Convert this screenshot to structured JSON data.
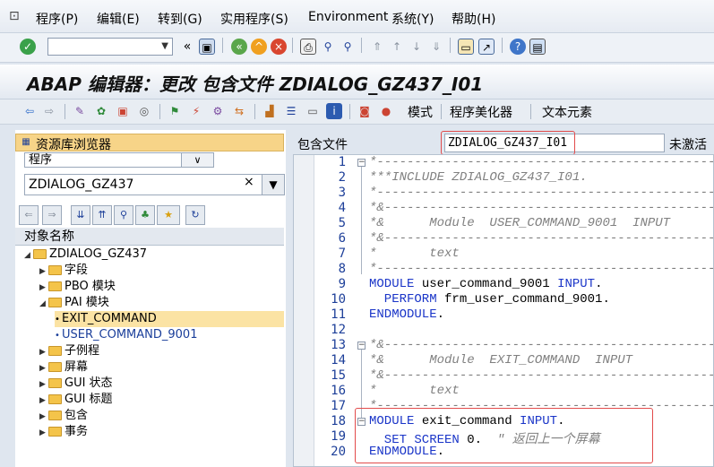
{
  "menu": {
    "items": [
      "程序(P)",
      "编辑(E)",
      "转到(G)",
      "实用程序(S)",
      "Environment",
      "系统(Y)",
      "帮助(H)"
    ]
  },
  "title": "ABAP 编辑器：更改 包含文件 ZDIALOG_GZ437_I01",
  "app_toolbar": {
    "mode_label": "模式",
    "pretty_printer_label": "程序美化器",
    "text_elements_label": "文本元素"
  },
  "repository_browser": {
    "header": "资源库浏览器",
    "object_type": "程序",
    "object_name": "ZDIALOG_GZ437",
    "clear_symbol": "×",
    "column_header": "对象名称",
    "tree": [
      {
        "label": "ZDIALOG_GZ437",
        "level": 0,
        "expanded": true,
        "folder": true
      },
      {
        "label": "字段",
        "level": 1,
        "expanded": false,
        "folder": true
      },
      {
        "label": "PBO 模块",
        "level": 1,
        "expanded": false,
        "folder": true
      },
      {
        "label": "PAI 模块",
        "level": 1,
        "expanded": true,
        "folder": true
      },
      {
        "label": "EXIT_COMMAND",
        "level": 2,
        "selected": true
      },
      {
        "label": "USER_COMMAND_9001",
        "level": 2,
        "selected": false
      },
      {
        "label": "子例程",
        "level": 1,
        "expanded": false,
        "folder": true
      },
      {
        "label": "屏幕",
        "level": 1,
        "expanded": false,
        "folder": true
      },
      {
        "label": "GUI 状态",
        "level": 1,
        "expanded": false,
        "folder": true
      },
      {
        "label": "GUI 标题",
        "level": 1,
        "expanded": false,
        "folder": true
      },
      {
        "label": "包含",
        "level": 1,
        "expanded": false,
        "folder": true
      },
      {
        "label": "事务",
        "level": 1,
        "expanded": false,
        "folder": true
      }
    ]
  },
  "editor": {
    "include_label": "包含文件",
    "include_name": "ZDIALOG_GZ437_I01",
    "status": "未激活",
    "lines": [
      {
        "n": "1",
        "text": "*-----------------------------------------------",
        "type": "comment"
      },
      {
        "n": "2",
        "text": "***INCLUDE ZDIALOG_GZ437_I01.",
        "type": "comment"
      },
      {
        "n": "3",
        "text": "*-----------------------------------------------",
        "type": "comment"
      },
      {
        "n": "4",
        "text": "*&----------------------------------------------",
        "type": "comment"
      },
      {
        "n": "5",
        "text": "*&      Module  USER_COMMAND_9001  INPUT",
        "type": "comment"
      },
      {
        "n": "6",
        "text": "*&----------------------------------------------",
        "type": "comment"
      },
      {
        "n": "7",
        "text": "*       text",
        "type": "comment"
      },
      {
        "n": "8",
        "text": "*-----------------------------------------------",
        "type": "comment"
      },
      {
        "n": "9",
        "k1": "MODULE",
        "t1": " user_command_9001 ",
        "k2": "INPUT",
        "t2": ".",
        "type": "code"
      },
      {
        "n": "10",
        "k1": "  PERFORM",
        "t1": " frm_user_command_9001.",
        "type": "code"
      },
      {
        "n": "11",
        "k1": "ENDMODULE",
        "t1": ".",
        "type": "code"
      },
      {
        "n": "12",
        "text": "",
        "type": "blank"
      },
      {
        "n": "13",
        "text": "*&----------------------------------------------",
        "type": "comment"
      },
      {
        "n": "14",
        "text": "*&      Module  EXIT_COMMAND  INPUT",
        "type": "comment"
      },
      {
        "n": "15",
        "text": "*&----------------------------------------------",
        "type": "comment"
      },
      {
        "n": "16",
        "text": "*       text",
        "type": "comment"
      },
      {
        "n": "17",
        "text": "*-----------------------------------------------",
        "type": "comment"
      },
      {
        "n": "18",
        "k1": "MODULE",
        "t1": " exit_command ",
        "k2": "INPUT",
        "t2": ".",
        "type": "code"
      },
      {
        "n": "19",
        "k1": "  SET SCREEN",
        "t1": " 0.  ",
        "c": "\" 返回上一个屏幕",
        "type": "code"
      },
      {
        "n": "20",
        "k1": "ENDMODULE",
        "t1": ".",
        "type": "code"
      }
    ]
  },
  "colors": {
    "keyword": "#1a35c8",
    "comment": "#808080",
    "highlight_box": "#e24b4b",
    "selected_node": "#fbe3a4"
  }
}
